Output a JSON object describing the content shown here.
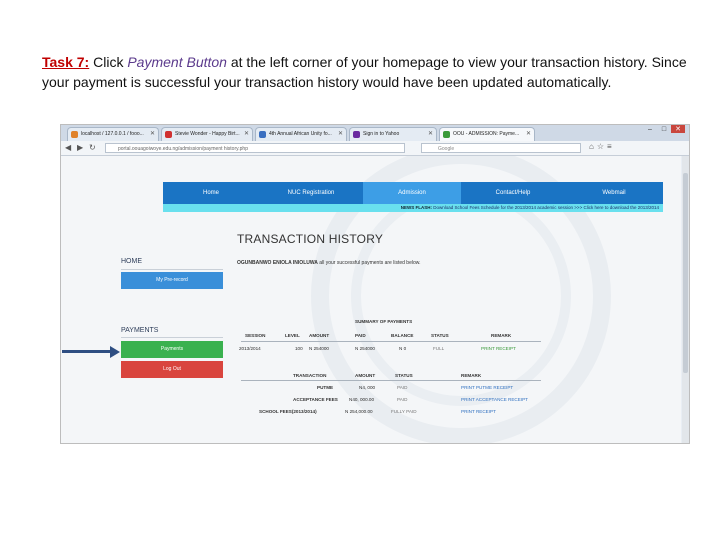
{
  "instructions": {
    "task_label": "Task 7:",
    "part1": " Click ",
    "emph": "Payment Button",
    "part2": " at the left corner of your homepage to view your transaction history. Since your payment is successful your transaction history would have been updated automatically."
  },
  "browser": {
    "tabs": [
      {
        "label": "localhost / 127.0.0.1 / fooo...",
        "favicon_color": "#e0822a"
      },
      {
        "label": "Stevie Wonder - Happy Birt...",
        "favicon_color": "#d03030"
      },
      {
        "label": "4th Annual African Unity fo...",
        "favicon_color": "#3a6fc0"
      },
      {
        "label": "Sign in to Yahoo",
        "favicon_color": "#6a2aa0"
      },
      {
        "label": "OOU - ADMISSION: Payme...",
        "favicon_color": "#3a9a3a"
      }
    ],
    "url": "portal.oouagoiwoye.edu.ng/admission/payment history.php",
    "search_placeholder": "Google",
    "controls": {
      "minimize": "–",
      "maximize": "□",
      "close": "✕"
    }
  },
  "nav": {
    "items": [
      "Home",
      "NUC Registration",
      "Admission",
      "Contact/Help",
      "Webmail"
    ],
    "active_index": 2,
    "color": "#1a74c4",
    "active_color": "#3d9ee6"
  },
  "news_flash": {
    "label": "NEWS FLASH:",
    "text": " Download School Fees Schedule for the 2013/2014 academic session >>> Click here to download the 2013/2014"
  },
  "page": {
    "title": "TRANSACTION HISTORY",
    "sidebar": {
      "home_heading": "HOME",
      "profile_button": "My Pre-record",
      "payments_heading": "PAYMENTS",
      "payments_button": "Payments",
      "logout_button": "Log Out"
    },
    "user_name": "OGUNBANWO ENIOLA INIOLUWA",
    "user_suffix": " all your successful payments are listed below."
  },
  "summary": {
    "headers": [
      "SESSION",
      "LEVEL",
      "AMOUNT",
      "PAID",
      "BALANCE",
      "STATUS",
      "REMARK"
    ],
    "group_heading": "SUMMARY OF PAYMENTS",
    "row": {
      "session": "2013/2014",
      "level": "100",
      "amount": "N 254000",
      "paid": "N 254000",
      "balance": "N 0",
      "status": "FULL",
      "remark": "PRINT RECEIPT"
    }
  },
  "transactions": {
    "headers": [
      "TRANSACTION",
      "AMOUNT",
      "STATUS",
      "REMARK"
    ],
    "rows": [
      {
        "name": "PUTME",
        "amount": "N4, 000",
        "status": "PAID",
        "remark": "PRINT PUTME RECEIPT"
      },
      {
        "name": "ACCEPTANCE FEES",
        "amount": "N40, 000.00",
        "status": "PAID",
        "remark": "PRINT ACCEPTANCE RECEIPT"
      },
      {
        "name": "SCHOOL FEES(2013/2014)",
        "amount": "N 254,000.00",
        "status": "FULLY PAID",
        "remark": "PRINT RECEIPT"
      }
    ]
  },
  "colors": {
    "arrow": "#2e4e82",
    "payments_button": "#3ab14f",
    "logout_button": "#d9453e",
    "profile_button": "#3a8fd9",
    "news_flash_bg": "#69e0ee",
    "task_label": "#c00000"
  }
}
